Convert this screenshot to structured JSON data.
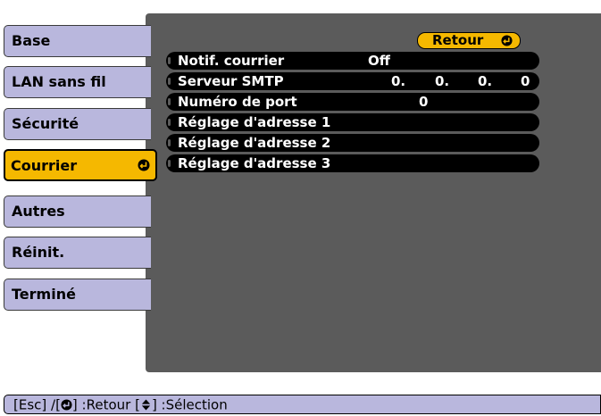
{
  "sidebar": {
    "items": [
      {
        "label": "Base",
        "active": false
      },
      {
        "label": "LAN sans fil",
        "active": false
      },
      {
        "label": "Sécurité",
        "active": false
      },
      {
        "label": "Courrier",
        "active": true
      },
      {
        "label": "Autres",
        "active": false
      },
      {
        "label": "Réinit.",
        "active": false
      },
      {
        "label": "Terminé",
        "active": false
      }
    ]
  },
  "main": {
    "back_button_label": "Retour",
    "settings": [
      {
        "label": "Notif. courrier",
        "value": "Off"
      },
      {
        "label": "Serveur SMTP",
        "ip": [
          "0.",
          "0.",
          "0.",
          "0"
        ]
      },
      {
        "label": "Numéro de port",
        "value": "0"
      },
      {
        "label": "Réglage d'adresse 1",
        "value": ""
      },
      {
        "label": "Réglage d'adresse 2",
        "value": ""
      },
      {
        "label": "Réglage d'adresse 3",
        "value": ""
      }
    ]
  },
  "help_bar": {
    "part1": "[Esc] /[",
    "part2": "] :Retour  [",
    "part3": "] :Sélection"
  },
  "icons": {
    "enter": "enter-icon",
    "updown": "up-down-arrows-icon"
  },
  "colors": {
    "panel_bg": "#5b5b5b",
    "menu_bg": "#b9b7dd",
    "highlight": "#f5b800",
    "row_bg": "#000000"
  }
}
